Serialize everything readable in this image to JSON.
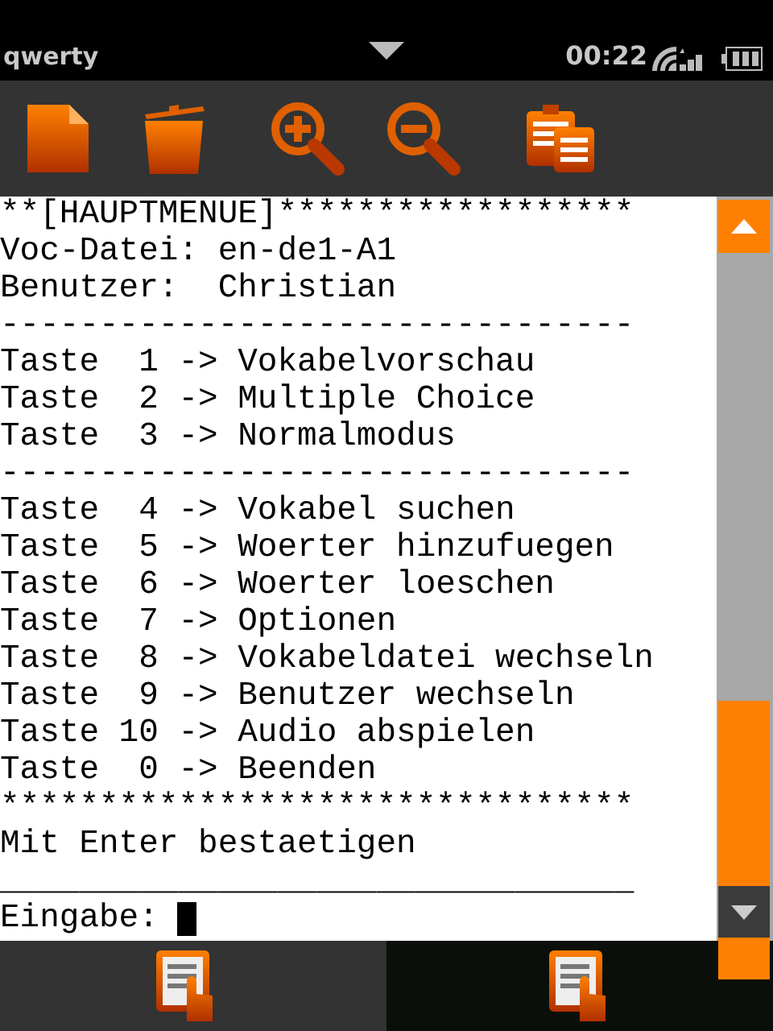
{
  "status_bar": {
    "app_name": "qwerty",
    "time": "00:22"
  },
  "terminal": {
    "lines": [
      "**[HAUPTMENUE]******************",
      "Voc-Datei: en-de1-A1",
      "Benutzer:  Christian",
      "--------------------------------",
      "Taste  1 -> Vokabelvorschau",
      "Taste  2 -> Multiple Choice",
      "Taste  3 -> Normalmodus",
      "--------------------------------",
      "Taste  4 -> Vokabel suchen",
      "Taste  5 -> Woerter hinzufuegen",
      "Taste  6 -> Woerter loeschen",
      "Taste  7 -> Optionen",
      "Taste  8 -> Vokabeldatei wechseln",
      "Taste  9 -> Benutzer wechseln",
      "Taste 10 -> Audio abspielen",
      "Taste  0 -> Beenden",
      "********************************",
      "Mit Enter bestaetigen",
      "________________________________"
    ],
    "prompt": "Eingabe:"
  },
  "bottom_tabs": [
    {
      "selected": true
    },
    {
      "selected": false
    }
  ]
}
